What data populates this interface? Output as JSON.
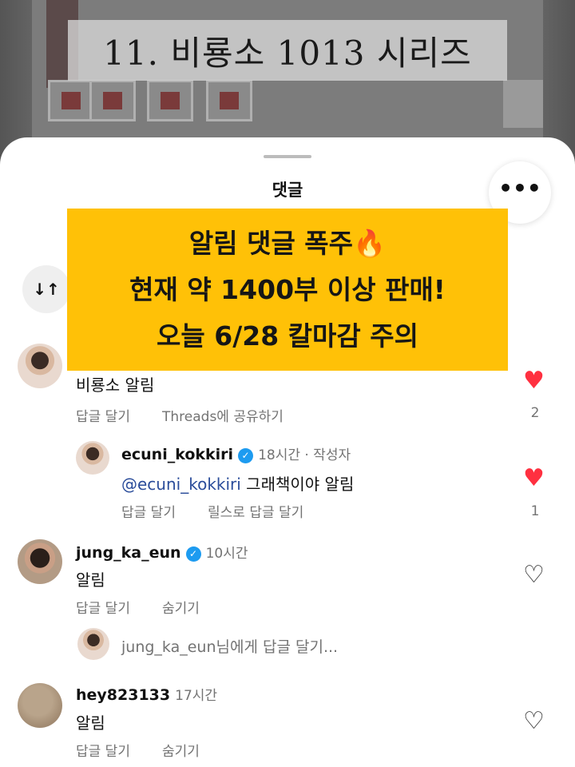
{
  "overlay_title": "11. 비룡소 1013 시리즈",
  "sheet": {
    "title": "댓글",
    "more_label": "•••",
    "sort_label": "↓↑"
  },
  "promo": {
    "line1": "알림 댓글 폭주",
    "flame": "🔥",
    "line2": "현재 약 1400부 이상 판매!",
    "line3": "오늘 6/28 칼마감 주의"
  },
  "comments": [
    {
      "text": "비룡소 알림",
      "reply_action": "답글 달기",
      "share_action": "Threads에 공유하기",
      "likes": "2",
      "liked": true
    },
    {
      "username": "ecuni_kokkiri",
      "verified": "✓",
      "time": "18시간 · 작성자",
      "mention": "@ecuni_kokkiri",
      "text": " 그래책이야 알림",
      "reply_action": "답글 달기",
      "reels_action": "릴스로 답글 달기",
      "likes": "1",
      "liked": true
    },
    {
      "username": "jung_ka_eun",
      "verified": "✓",
      "time": "10시간",
      "text": "알림",
      "reply_action": "답글 달기",
      "hide_action": "숨기기",
      "reply_placeholder": "jung_ka_eun님에게 답글 달기..."
    },
    {
      "username": "hey823133",
      "time": "17시간",
      "text": "알림",
      "reply_action": "답글 달기",
      "hide_action": "숨기기"
    }
  ],
  "icons": {
    "heart_filled": "♥",
    "heart_outline": "♡"
  },
  "colors": {
    "promo_bg": "#ffc107",
    "heart_red": "#ff3040",
    "verified_blue": "#1d9bf0",
    "mention_blue": "#2a4c9a"
  }
}
